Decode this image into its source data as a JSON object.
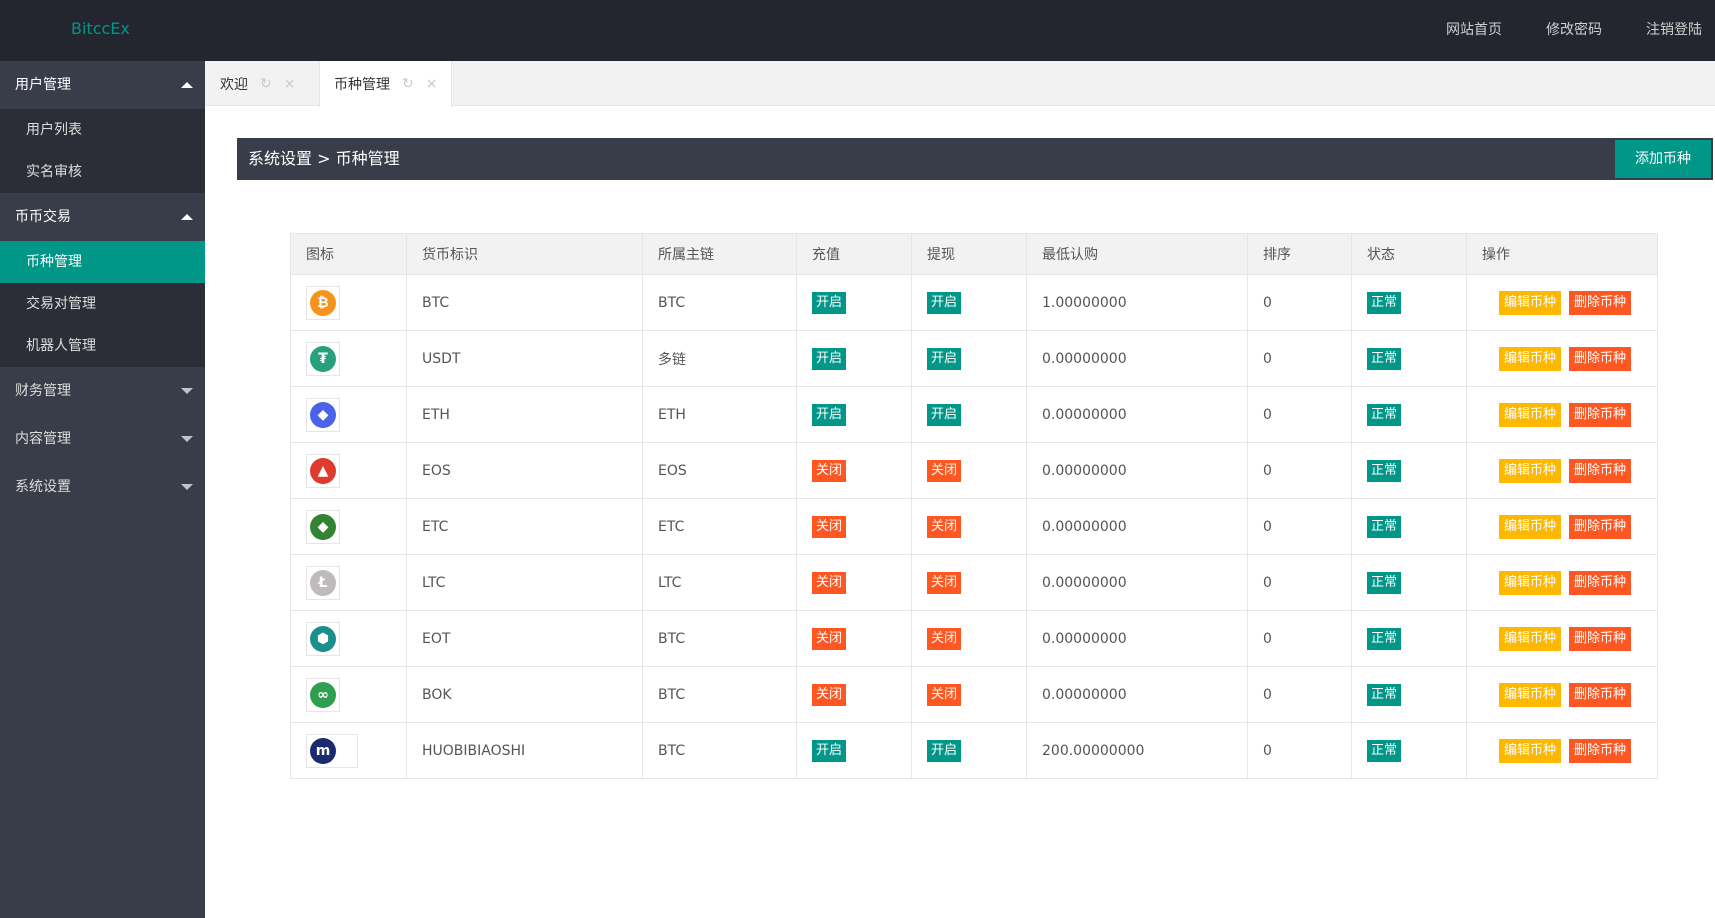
{
  "brand": "BitccEx",
  "topnav": [
    "网站首页",
    "修改密码",
    "注销登陆"
  ],
  "sidebar": [
    {
      "label": "用户管理",
      "expanded": true,
      "items": [
        "用户列表",
        "实名审核"
      ]
    },
    {
      "label": "币币交易",
      "expanded": true,
      "items": [
        "币种管理",
        "交易对管理",
        "机器人管理"
      ],
      "active": "币种管理"
    },
    {
      "label": "财务管理",
      "expanded": false,
      "items": []
    },
    {
      "label": "内容管理",
      "expanded": false,
      "items": []
    },
    {
      "label": "系统设置",
      "expanded": false,
      "items": []
    }
  ],
  "tabs": [
    {
      "label": "欢迎",
      "active": false
    },
    {
      "label": "币种管理",
      "active": true
    }
  ],
  "tab_icons": {
    "refresh": "↻",
    "close": "×"
  },
  "breadcrumb": "系统设置 > 币种管理",
  "add_button": "添加币种",
  "table": {
    "headers": [
      "图标",
      "货币标识",
      "所属主链",
      "充值",
      "提现",
      "最低认购",
      "排序",
      "状态",
      "操作"
    ],
    "edit_label": "编辑币种",
    "delete_label": "删除币种",
    "rows": [
      {
        "icon": "bitcoin-icon",
        "glyph": "₿",
        "color": "#f7931a",
        "symbol": "BTC",
        "chain": "BTC",
        "recharge": "开启",
        "withdraw": "开启",
        "min": "1.00000000",
        "sort": "0",
        "status": "正常"
      },
      {
        "icon": "tether-icon",
        "glyph": "₮",
        "color": "#26a17b",
        "symbol": "USDT",
        "chain": "多链",
        "recharge": "开启",
        "withdraw": "开启",
        "min": "0.00000000",
        "sort": "0",
        "status": "正常"
      },
      {
        "icon": "ethereum-icon",
        "glyph": "◆",
        "color": "#4a63e8",
        "symbol": "ETH",
        "chain": "ETH",
        "recharge": "开启",
        "withdraw": "开启",
        "min": "0.00000000",
        "sort": "0",
        "status": "正常"
      },
      {
        "icon": "eos-icon",
        "glyph": "▲",
        "color": "#e03a2f",
        "symbol": "EOS",
        "chain": "EOS",
        "recharge": "关闭",
        "withdraw": "关闭",
        "min": "0.00000000",
        "sort": "0",
        "status": "正常"
      },
      {
        "icon": "ethereum-classic-icon",
        "glyph": "◆",
        "color": "#328332",
        "symbol": "ETC",
        "chain": "ETC",
        "recharge": "关闭",
        "withdraw": "关闭",
        "min": "0.00000000",
        "sort": "0",
        "status": "正常"
      },
      {
        "icon": "litecoin-icon",
        "glyph": "Ł",
        "color": "#bfbbbb",
        "symbol": "LTC",
        "chain": "LTC",
        "recharge": "关闭",
        "withdraw": "关闭",
        "min": "0.00000000",
        "sort": "0",
        "status": "正常"
      },
      {
        "icon": "eot-icon",
        "glyph": "⬢",
        "color": "#1b8e8e",
        "symbol": "EOT",
        "chain": "BTC",
        "recharge": "关闭",
        "withdraw": "关闭",
        "min": "0.00000000",
        "sort": "0",
        "status": "正常"
      },
      {
        "icon": "bok-icon",
        "glyph": "∞",
        "color": "#2e9e4f",
        "symbol": "BOK",
        "chain": "BTC",
        "recharge": "关闭",
        "withdraw": "关闭",
        "min": "0.00000000",
        "sort": "0",
        "status": "正常"
      },
      {
        "icon": "huobi-m-icon",
        "glyph": "m",
        "color": "#1a2a6c",
        "symbol": "HUOBIBIAOSHI",
        "chain": "BTC",
        "recharge": "开启",
        "withdraw": "开启",
        "min": "200.00000000",
        "sort": "0",
        "status": "正常",
        "wide": true
      }
    ]
  }
}
